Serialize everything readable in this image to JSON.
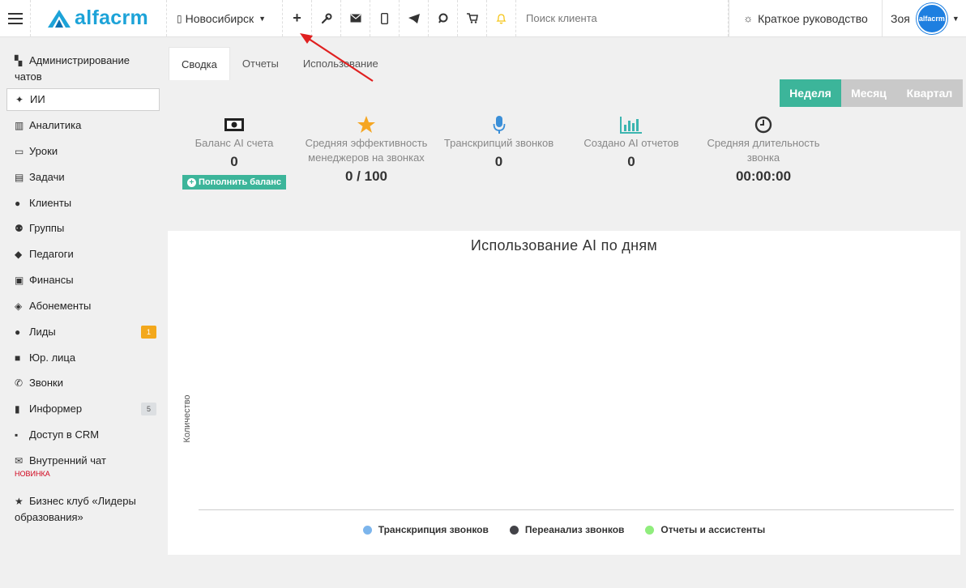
{
  "topbar": {
    "logo_text": "alfacrm",
    "city": "Новосибирск",
    "search_placeholder": "Поиск клиента",
    "guide_label": "Краткое руководство",
    "user_name": "Зоя",
    "avatar_text": "alfacrm"
  },
  "sidebar": {
    "items": [
      {
        "label": "Администрирование чатов",
        "icon": "chats-icon"
      },
      {
        "label": "ИИ",
        "icon": "ai-sparkle-icon"
      },
      {
        "label": "Аналитика",
        "icon": "map-icon"
      },
      {
        "label": "Уроки",
        "icon": "calendar-icon"
      },
      {
        "label": "Задачи",
        "icon": "clipboard-icon"
      },
      {
        "label": "Клиенты",
        "icon": "user-icon"
      },
      {
        "label": "Группы",
        "icon": "users-icon"
      },
      {
        "label": "Педагоги",
        "icon": "graduation-cap-icon"
      },
      {
        "label": "Финансы",
        "icon": "money-icon"
      },
      {
        "label": "Абонементы",
        "icon": "tag-icon"
      },
      {
        "label": "Лиды",
        "icon": "user-plus-icon",
        "badge": "1"
      },
      {
        "label": "Юр. лица",
        "icon": "briefcase-icon"
      },
      {
        "label": "Звонки",
        "icon": "phone-icon"
      },
      {
        "label": "Информер",
        "icon": "book-icon",
        "badge": "5"
      },
      {
        "label": "Доступ в CRM",
        "icon": "lock-icon"
      },
      {
        "label": "Внутренний чат",
        "icon": "envelope-icon",
        "note": "НОВИНКА"
      },
      {
        "label": "Бизнес клуб «Лидеры образования»",
        "icon": "star-icon"
      }
    ]
  },
  "tabs": [
    "Сводка",
    "Отчеты",
    "Использование"
  ],
  "periods": [
    "Неделя",
    "Месяц",
    "Квартал"
  ],
  "stats": [
    {
      "label": "Баланс AI счета",
      "value": "0",
      "action": "Пополнить баланс"
    },
    {
      "label": "Средняя эффективность менеджеров на звонках",
      "value": "0 / 100"
    },
    {
      "label": "Транскрипций звонков",
      "value": "0"
    },
    {
      "label": "Создано AI отчетов",
      "value": "0"
    },
    {
      "label": "Средняя длительность звонка",
      "value": "00:00:00"
    }
  ],
  "colors": {
    "accent": "#3cb59a",
    "star": "#f5a623",
    "icon_blue": "#3b8fd8",
    "icon_teal": "#3cb5b0",
    "badge_orange": "#f3a81c",
    "annotation_arrow": "#e02020"
  },
  "chart_data": {
    "type": "line",
    "title": "Использование AI по дням",
    "xlabel": "",
    "ylabel": "Количество",
    "series": [
      {
        "name": "Транскрипция звонков",
        "color": "#7cb5ec",
        "values": []
      },
      {
        "name": "Переанализ звонков",
        "color": "#434348",
        "values": []
      },
      {
        "name": "Отчеты и ассистенты",
        "color": "#90ed7d",
        "values": []
      }
    ]
  }
}
